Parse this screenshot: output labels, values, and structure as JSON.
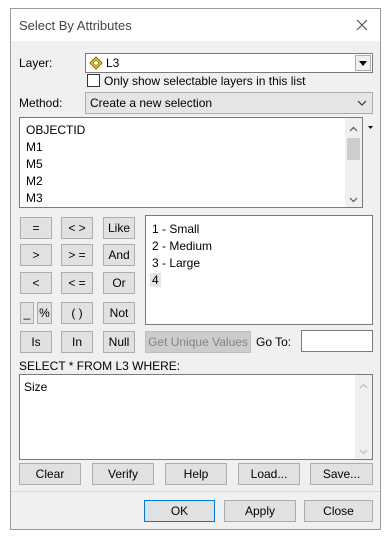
{
  "window": {
    "title": "Select By Attributes",
    "close_icon": "close-icon"
  },
  "layer": {
    "label": "Layer:",
    "value": "L3",
    "icon": "layer-diamond-icon",
    "only_selectable_label": "Only show selectable layers in this list",
    "only_selectable_checked": false
  },
  "method": {
    "label": "Method:",
    "value": "Create a new selection"
  },
  "fields": {
    "items": [
      "OBJECTID",
      "M1",
      "M5",
      "M2",
      "M3"
    ]
  },
  "operators": {
    "equal": "=",
    "not_equal": "< >",
    "like": "Like",
    "greater": ">",
    "greater_equal": "> =",
    "and": "And",
    "less": "<",
    "less_equal": "< =",
    "or": "Or",
    "underscore": "_",
    "percent": "%",
    "parens": "( )",
    "not": "Not",
    "is": "Is",
    "in": "In",
    "null": "Null"
  },
  "values": {
    "items": [
      "1 - Small",
      "2 - Medium",
      "3 - Large",
      "4"
    ],
    "selected_index": 3
  },
  "unique": {
    "get_unique_label": "Get Unique Values",
    "goto_label": "Go To:",
    "goto_value": ""
  },
  "query": {
    "header": "SELECT * FROM L3 WHERE:",
    "text": "Size"
  },
  "actions": {
    "clear": "Clear",
    "verify": "Verify",
    "help": "Help",
    "load": "Load...",
    "save": "Save..."
  },
  "footer": {
    "ok": "OK",
    "apply": "Apply",
    "close": "Close"
  },
  "colors": {
    "dialog_bg": "#f0f0f0",
    "selected_item_bg": "#e5e5e5",
    "focus_border": "#0078d7"
  }
}
